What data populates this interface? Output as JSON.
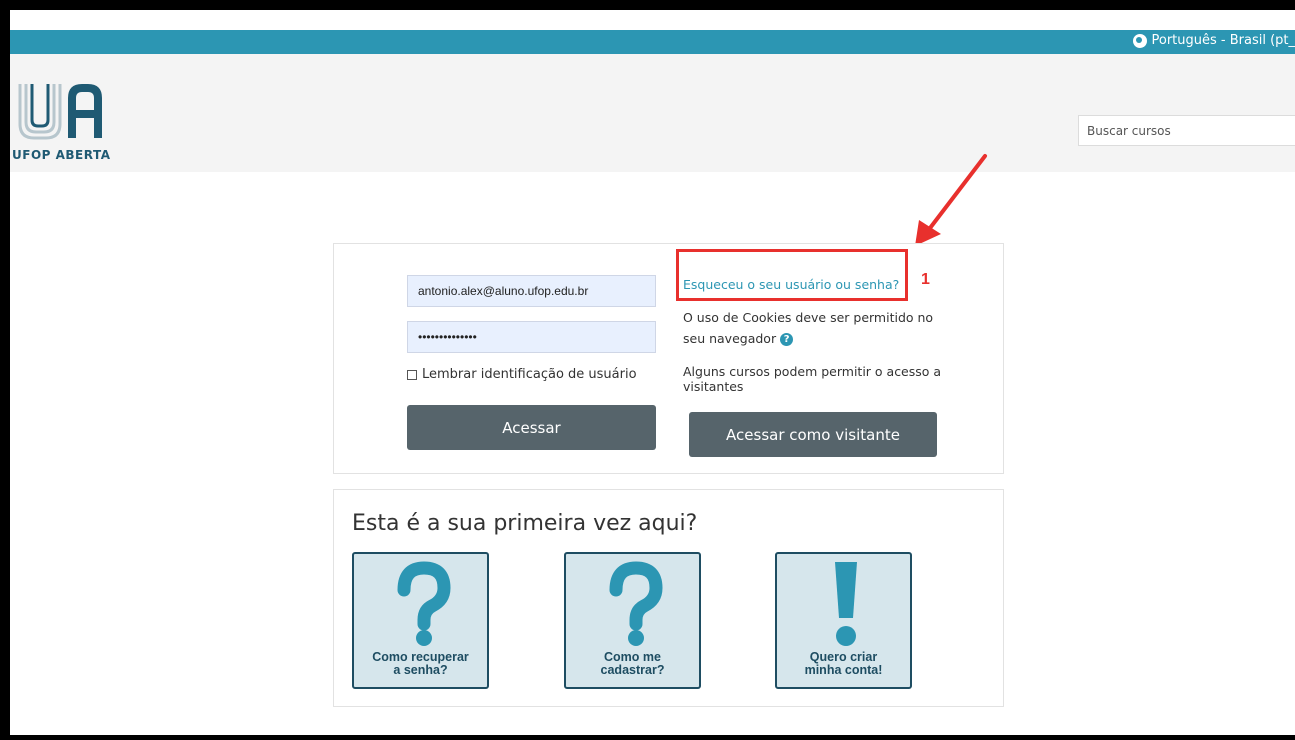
{
  "topbar": {
    "language": "Português - Brasil (pt_"
  },
  "header": {
    "logo_text": "UFOP ABERTA",
    "search_placeholder": "Buscar cursos"
  },
  "login": {
    "username_value": "antonio.alex@aluno.ufop.edu.br",
    "password_value": "••••••••••••••",
    "remember_label": "Lembrar identificação de usuário",
    "login_button": "Acessar",
    "forgot_link": "Esqueceu o seu usuário ou senha?",
    "annotation_number": "1",
    "cookie_text": "O uso de Cookies deve ser permitido no seu navegador",
    "guest_text": "Alguns cursos podem permitir o acesso a visitantes",
    "guest_button": "Acessar como visitante"
  },
  "first_time": {
    "title": "Esta é a sua primeira vez aqui?",
    "cards": [
      {
        "label": "Como recuperar\na senha?",
        "icon": "question-mark-icon"
      },
      {
        "label": "Como me\ncadastrar?",
        "icon": "question-mark-icon"
      },
      {
        "label": "Quero criar\nminha conta!",
        "icon": "exclamation-mark-icon"
      }
    ]
  },
  "colors": {
    "topbar": "#2c96b3",
    "button": "#56646b",
    "annotation": "#e8302d",
    "card_bg": "#d6e6ec",
    "card_border": "#1e4d62"
  }
}
